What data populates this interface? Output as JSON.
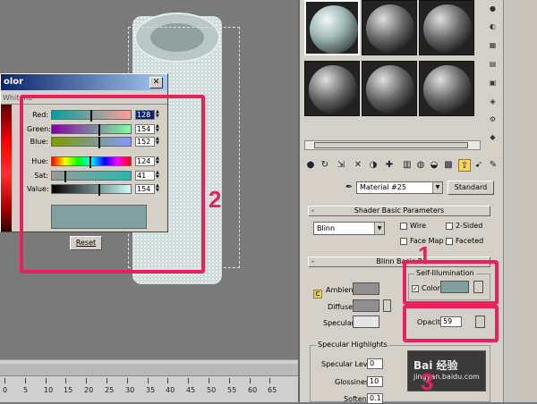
{
  "dialog": {
    "title": "olor",
    "tab": "Whitene",
    "close_glyph": "✕",
    "sliders": [
      {
        "name": "Red:",
        "value": "128",
        "selected": true,
        "pos": 0.5,
        "gradient": "linear-gradient(to right,#00a09e,#ffa09e)"
      },
      {
        "name": "Green:",
        "value": "154",
        "selected": false,
        "pos": 0.6,
        "gradient": "linear-gradient(to right,#8000a0,#80ffa0)"
      },
      {
        "name": "Blue:",
        "value": "152",
        "selected": false,
        "pos": 0.6,
        "gradient": "linear-gradient(to right,#809a00,#809aff)"
      },
      {
        "name": "Hue:",
        "value": "124",
        "selected": false,
        "pos": 0.49,
        "gradient": "linear-gradient(to right,#f00,#ff0,#0f0,#0ff,#00f,#f0f,#f00)"
      },
      {
        "name": "Sat:",
        "value": "41",
        "selected": false,
        "pos": 0.16,
        "gradient": "linear-gradient(to right,#9a9a9a,#2ab5b0)"
      },
      {
        "name": "Value:",
        "value": "154",
        "selected": false,
        "pos": 0.6,
        "gradient": "linear-gradient(to right,#000,#c8fffb)"
      }
    ],
    "reset_label": "Reset"
  },
  "annotations": {
    "one": "1",
    "two": "2",
    "three": "3"
  },
  "ruler": {
    "labels": [
      "0",
      "5",
      "10",
      "15",
      "20",
      "25",
      "30",
      "35",
      "40",
      "45",
      "50",
      "55",
      "60",
      "65"
    ]
  },
  "panel": {
    "material_name": "Material #25",
    "standard_label": "Standard",
    "shader_rollout": "Shader Basic Parameters",
    "shader_type": "Blinn",
    "checks": {
      "wire": "Wire",
      "two_sided": "2-Sided",
      "face_map": "Face Map",
      "faceted": "Faceted"
    },
    "blinn_rollout": "Blinn Basic P",
    "ambient": "Ambient:",
    "diffuse": "Diffuse:",
    "specular": "Specular:",
    "self_illum_title": "Self-Illumination",
    "color_check": "Color",
    "opacity_label": "Opacity:",
    "opacity_value": "59",
    "spec_highlights": "Specular Highlights",
    "spec_level_label": "Specular Level:",
    "spec_level_value": "0",
    "glossiness_label": "Glossiness:",
    "glossiness_value": "10",
    "soften_label": "Soften:",
    "soften_value": "0.1",
    "rollout_minus": "-",
    "check_mark": "✓",
    "dropdown_arrow": "▼",
    "lock_letter": "C"
  },
  "watermark": {
    "text": "Bai 经验",
    "sub": "jingyan.baidu.com"
  },
  "colors": {
    "highlight": "#e8205c",
    "self_illum_swatch": "#7fa09e"
  }
}
